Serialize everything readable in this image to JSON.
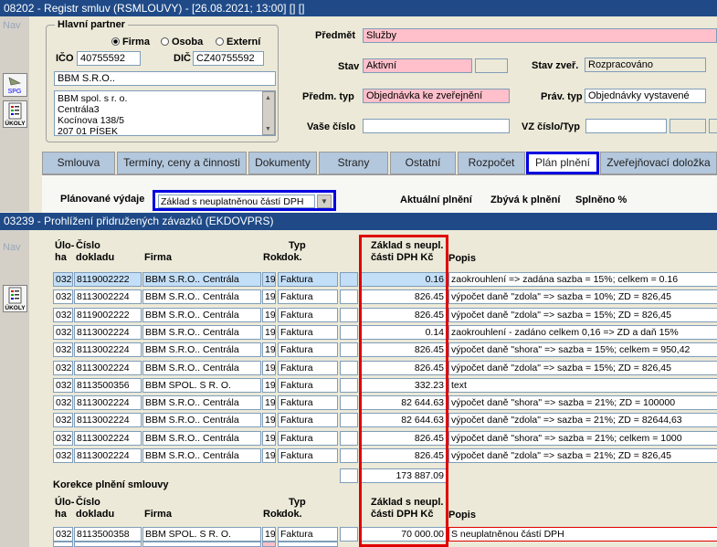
{
  "window1": {
    "title": "08202 - Registr smluv (RSMLOUVY) - [26.08.2021; 13:00] [] []",
    "nav_label": "Nav"
  },
  "window2": {
    "title": "03239 - Prohlížení přidružených závazků (EKDOVPRS)",
    "nav_label": "Nav"
  },
  "icons": {
    "spg_label": "SPG",
    "ukoly_label": "ÚKOLY"
  },
  "partner": {
    "group_label": "Hlavní partner",
    "radio_firma": "Firma",
    "radio_osoba": "Osoba",
    "radio_externi": "Externí",
    "selected": "Firma",
    "ico_label": "IČO",
    "ico_value": "40755592",
    "dic_label": "DIČ",
    "dic_value": "CZ40755592",
    "name_value": "BBM S.R.O..",
    "address_lines": [
      "BBM spol. s r. o.",
      "Centrála3",
      "Kocínova 138/5",
      "207 01 PÍSEK"
    ]
  },
  "contract": {
    "predmet_label": "Předmět",
    "predmet_value": "Služby",
    "stav_label": "Stav",
    "stav_value": "Aktivní",
    "stav_zver_label": "Stav zveř.",
    "stav_zver_value": "Rozpracováno",
    "predm_typ_label": "Předm. typ",
    "predm_typ_value": "Objednávka ke zveřejnění",
    "prav_typ_label": "Práv. typ",
    "prav_typ_value": "Objednávky vystavené",
    "vase_cislo_label": "Vaše číslo",
    "vase_cislo_value": "",
    "vz_label": "VZ číslo/Typ",
    "vz_value": ""
  },
  "tabs": [
    {
      "label": "Smlouva"
    },
    {
      "label": "Termíny, ceny a činnosti"
    },
    {
      "label": "Dokumenty"
    },
    {
      "label": "Strany"
    },
    {
      "label": "Ostatní"
    },
    {
      "label": "Rozpočet"
    },
    {
      "label": "Plán plnění"
    },
    {
      "label": "Zveřejňovací doložka"
    }
  ],
  "plan": {
    "planovane_label": "Plánované výdaje",
    "planovane_value": "Základ s neuplatněnou částí DPH",
    "aktualni_label": "Aktuální plnění",
    "zbyva_label": "Zbývá k plnění",
    "splneno_label": "Splněno %"
  },
  "columns": {
    "uloha_1": "Úlo-",
    "uloha_2": "ha",
    "cislo_1": "Číslo",
    "cislo_2": "dokladu",
    "firma": "Firma",
    "rok": "Rok",
    "typ_1": "Typ",
    "typ_2": "dok.",
    "zaklad_1": "Základ s neupl.",
    "zaklad_2": "části DPH Kč",
    "popis": "Popis"
  },
  "rows": [
    {
      "uloha": "032",
      "cislo": "8119002222",
      "firma": "BBM S.R.O.. Centrála",
      "rok": "19",
      "typ": "Faktura",
      "zaklad": "0.16",
      "popis": "zaokrouhlení => zadána sazba = 15%; celkem = 0.16"
    },
    {
      "uloha": "032",
      "cislo": "8113002224",
      "firma": "BBM S.R.O.. Centrála",
      "rok": "19",
      "typ": "Faktura",
      "zaklad": "826.45",
      "popis": "výpočet daně \"zdola\" => sazba = 10%; ZD = 826,45"
    },
    {
      "uloha": "032",
      "cislo": "8119002222",
      "firma": "BBM S.R.O.. Centrála",
      "rok": "19",
      "typ": "Faktura",
      "zaklad": "826.45",
      "popis": "výpočet daně \"zdola\" => sazba = 15%; ZD = 826,45"
    },
    {
      "uloha": "032",
      "cislo": "8113002224",
      "firma": "BBM S.R.O.. Centrála",
      "rok": "19",
      "typ": "Faktura",
      "zaklad": "0.14",
      "popis": "zaokrouhlení - zadáno celkem 0,16 => ZD a daň 15%"
    },
    {
      "uloha": "032",
      "cislo": "8113002224",
      "firma": "BBM S.R.O.. Centrála",
      "rok": "19",
      "typ": "Faktura",
      "zaklad": "826.45",
      "popis": "výpočet daně \"shora\" => sazba = 15%; celkem = 950,42"
    },
    {
      "uloha": "032",
      "cislo": "8113002224",
      "firma": "BBM S.R.O.. Centrála",
      "rok": "19",
      "typ": "Faktura",
      "zaklad": "826.45",
      "popis": "výpočet daně \"zdola\" => sazba = 15%; ZD = 826,45"
    },
    {
      "uloha": "032",
      "cislo": "8113500356",
      "firma": "BBM SPOL. S R. O.",
      "rok": "19",
      "typ": "Faktura",
      "zaklad": "332.23",
      "popis": "text"
    },
    {
      "uloha": "032",
      "cislo": "8113002224",
      "firma": "BBM S.R.O.. Centrála",
      "rok": "19",
      "typ": "Faktura",
      "zaklad": "82 644.63",
      "popis": "výpočet daně \"shora\" => sazba = 21%; ZD = 100000"
    },
    {
      "uloha": "032",
      "cislo": "8113002224",
      "firma": "BBM S.R.O.. Centrála",
      "rok": "19",
      "typ": "Faktura",
      "zaklad": "82 644.63",
      "popis": "výpočet daně \"zdola\" => sazba = 21%; ZD = 82644,63"
    },
    {
      "uloha": "032",
      "cislo": "8113002224",
      "firma": "BBM S.R.O.. Centrála",
      "rok": "19",
      "typ": "Faktura",
      "zaklad": "826.45",
      "popis": "výpočet daně \"shora\" => sazba = 21%; celkem = 1000"
    },
    {
      "uloha": "032",
      "cislo": "8113002224",
      "firma": "BBM S.R.O.. Centrála",
      "rok": "19",
      "typ": "Faktura",
      "zaklad": "826.45",
      "popis": "výpočet daně \"zdola\" => sazba = 21%; ZD = 826,45"
    }
  ],
  "total": "173 887.09",
  "correction": {
    "section_label": "Korekce plnění smlouvy",
    "rows": [
      {
        "uloha": "032",
        "cislo": "8113500358",
        "firma": "BBM SPOL. S R. O.",
        "rok": "19",
        "typ": "Faktura",
        "zaklad": "70 000.00",
        "popis": "S neuplatněnou částí DPH"
      }
    ]
  },
  "colors": {
    "title_bar": "#1f4a87",
    "pink_field": "#ffc0cb",
    "highlight_blue": "#0000e0",
    "highlight_red": "#e00000",
    "tab_bg": "#b3c7dd",
    "row_blue": "#c3def7"
  }
}
